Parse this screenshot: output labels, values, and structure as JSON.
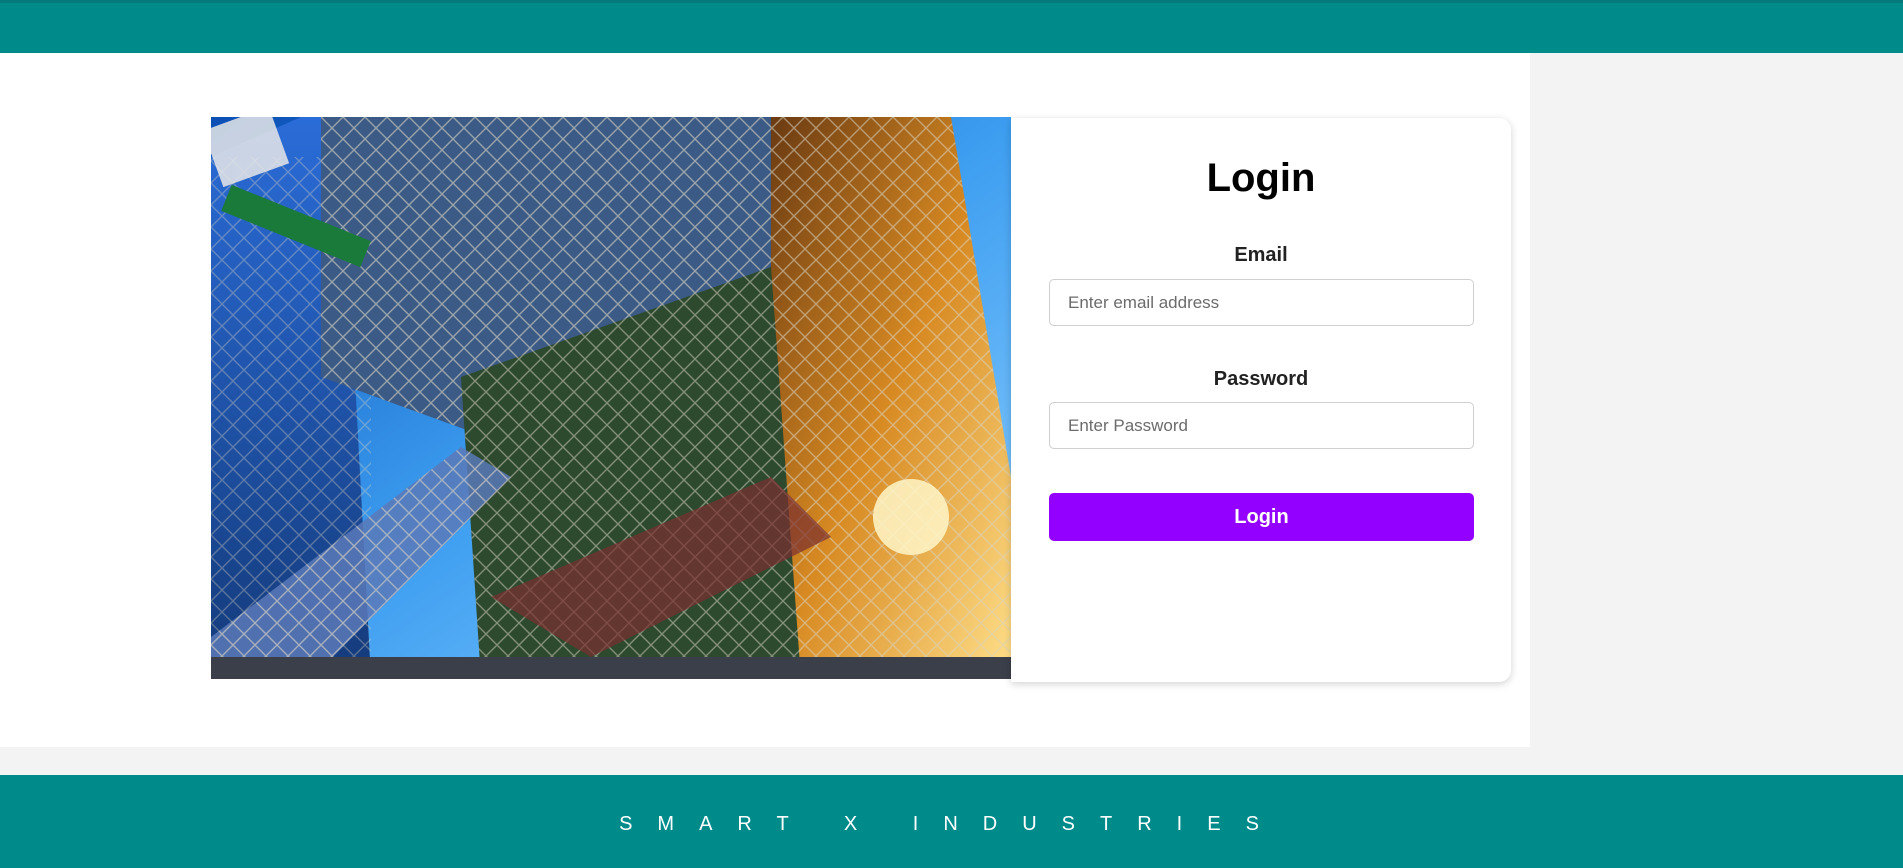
{
  "login": {
    "title": "Login",
    "email_label": "Email",
    "email_placeholder": "Enter email address",
    "password_label": "Password",
    "password_placeholder": "Enter Password",
    "submit_label": "Login"
  },
  "hero": {
    "image_description": "building-photo"
  },
  "footer": {
    "brand": "SMART X INDUSTRIES"
  },
  "colors": {
    "header": "#008b8b",
    "footer": "#008b8b",
    "accent_button": "#9400ff"
  }
}
